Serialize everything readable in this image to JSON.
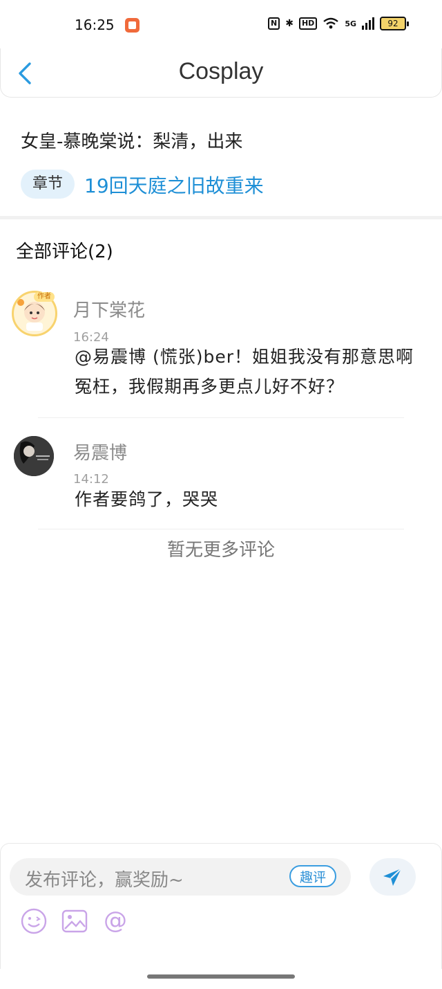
{
  "status_bar": {
    "time": "16:25",
    "nfc": "N",
    "bt": "✱",
    "hd": "HD",
    "net": "5G",
    "battery": "92"
  },
  "header": {
    "title": "Cosplay"
  },
  "chapter": {
    "quote": "女皇-慕晚棠说：梨清，出来",
    "tag": "章节",
    "link": "19回天庭之旧故重来"
  },
  "comments_heading": "全部评论(2)",
  "comments": [
    {
      "name": "月下棠花",
      "time": "16:24",
      "text": "@易震博 (慌张)ber！姐姐我没有那意思啊冤枉，我假期再多更点儿好不好？",
      "badge": "作者"
    },
    {
      "name": "易震博",
      "time": "14:12",
      "text": "作者要鸽了，哭哭"
    }
  ],
  "no_more": "暂无更多评论",
  "composer": {
    "placeholder": "发布评论，赢奖励~",
    "qu_label": "趣评"
  },
  "colors": {
    "accent": "#1e8fd6",
    "tool_purple": "#c9a4e8"
  }
}
